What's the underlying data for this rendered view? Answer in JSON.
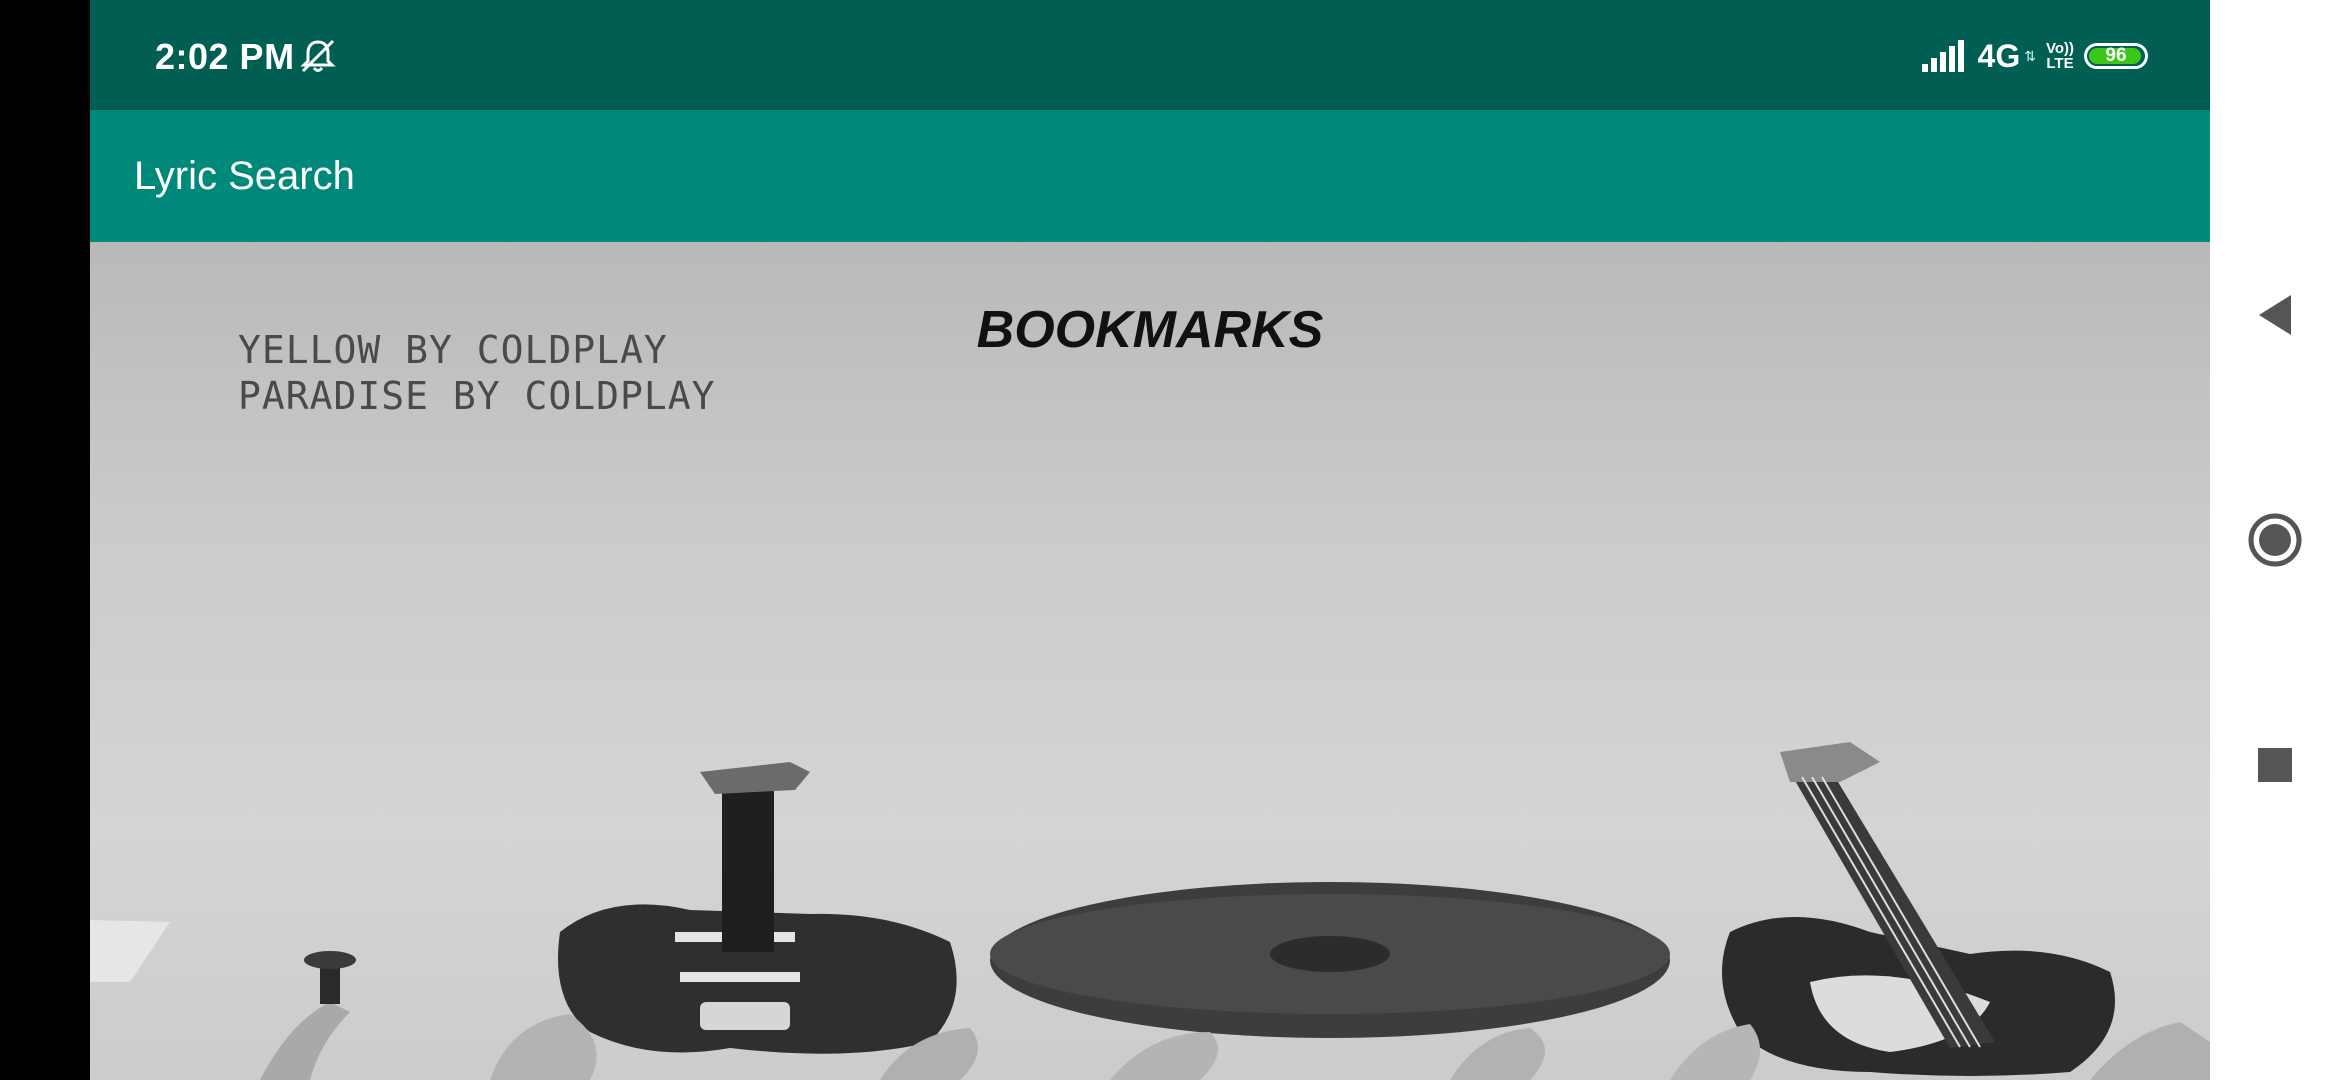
{
  "status_bar": {
    "time": "2:02 PM",
    "bell_icon": "bell-off-icon",
    "network": "4G",
    "volte_top": "Vo))",
    "volte_bottom": "LTE",
    "battery_level": "96",
    "battery_fraction": 0.96,
    "background_color": "#005e52"
  },
  "app_bar": {
    "title": "Lyric Search",
    "background_color": "#00897b"
  },
  "content": {
    "heading": "BOOKMARKS",
    "bookmarks": [
      "YELLOW BY COLDPLAY",
      "PARADISE BY COLDPLAY"
    ],
    "background_image": "hands-holding-instruments-photo"
  },
  "nav_bar": {
    "back_icon": "back-triangle-icon",
    "home_icon": "home-circle-icon",
    "recent_icon": "recent-apps-square-icon"
  }
}
